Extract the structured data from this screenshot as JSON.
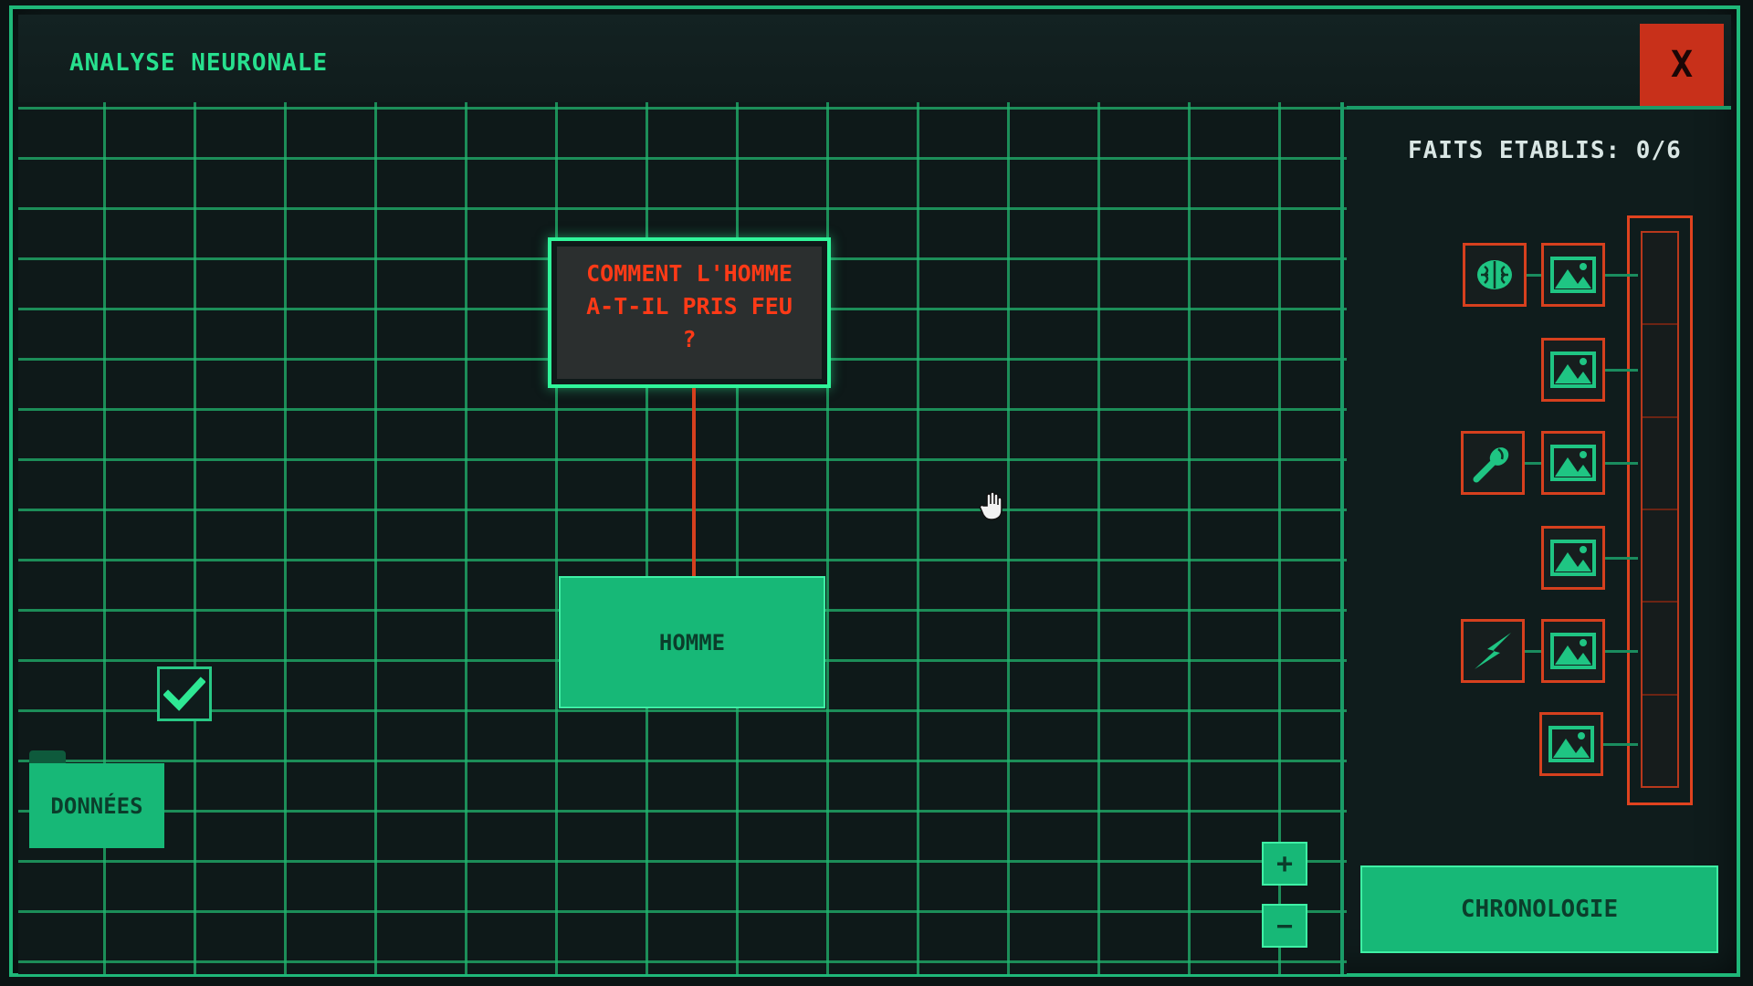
{
  "window": {
    "title": "ANALYSE NEURONALE",
    "close_label": "X"
  },
  "board": {
    "question_lines": [
      "COMMENT L'HOMME",
      "A-T-IL PRIS FEU",
      "?"
    ],
    "node_label": "HOMME"
  },
  "toolbar": {
    "donnees_label": "DONNÉES",
    "zoom_in_label": "+",
    "zoom_out_label": "−",
    "chronologie_label": "CHRONOLOGIE"
  },
  "facts": {
    "label": "FAITS ETABLIS: 0/6",
    "established": 0,
    "total": 6,
    "rows": [
      {
        "clue_icon": "brain-icon",
        "evidence_icon": "image-icon"
      },
      {
        "clue_icon": null,
        "evidence_icon": "image-icon"
      },
      {
        "clue_icon": "lighter-icon",
        "evidence_icon": "image-icon"
      },
      {
        "clue_icon": null,
        "evidence_icon": "image-icon"
      },
      {
        "clue_icon": "lightning-icon",
        "evidence_icon": "image-icon"
      },
      {
        "clue_icon": null,
        "evidence_icon": "image-icon"
      }
    ]
  },
  "colors": {
    "accent_green": "#17b877",
    "grid_green": "#20b46e",
    "alert_red": "#d6401e",
    "close_red": "#c8301a"
  }
}
